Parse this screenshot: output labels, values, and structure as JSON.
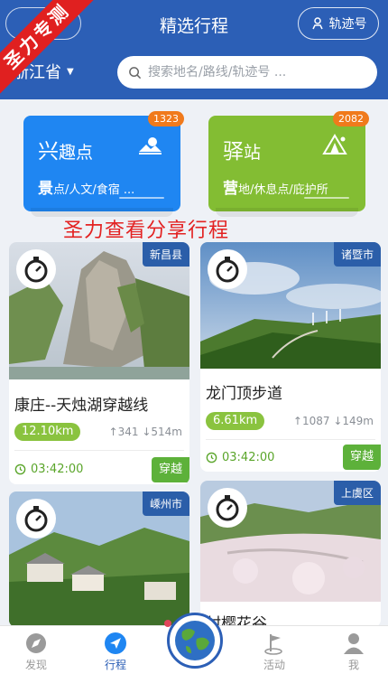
{
  "header": {
    "title": "精选行程",
    "track_button_label": "轨迹号",
    "region": "浙江省",
    "search_placeholder": "搜索地名/路线/轨迹号 ..."
  },
  "ribbon_text": "圣力专测",
  "categories": [
    {
      "title_lead": "兴",
      "title_rest": "趣点",
      "badge": "1323",
      "sub_lead": "景",
      "sub_rest": "点/人文/食宿 ...",
      "color": "#1f86f2"
    },
    {
      "title_lead": "驿",
      "title_rest": "站",
      "badge": "2082",
      "sub_lead": "营",
      "sub_rest": "地/休息点/庇护所",
      "color": "#83bd33"
    }
  ],
  "share_banner": "圣力查看分享行程",
  "trips": [
    {
      "county": "新昌县",
      "name": "康庄--天烛湖穿越线",
      "distance": "12.10km",
      "ascent": "341",
      "descent": "514m",
      "duration": "03:42:00",
      "action": "穿越"
    },
    {
      "county": "诸暨市",
      "name": "龙门顶步道",
      "distance": "6.61km",
      "ascent": "1087",
      "descent": "149m",
      "duration": "03:42:00",
      "action": "穿越"
    },
    {
      "county": "嵊州市"
    },
    {
      "county": "上虞区",
      "name_partial": "村樱花谷"
    }
  ],
  "nav": {
    "items": [
      {
        "label": "发现",
        "icon": "discover-icon"
      },
      {
        "label": "行程",
        "icon": "navigate-icon"
      },
      {
        "label": "活动",
        "icon": "flag-icon"
      },
      {
        "label": "我",
        "icon": "person-icon"
      }
    ],
    "center_icon": "globe-icon"
  },
  "colors": {
    "brand_blue": "#2c5fb6",
    "poi_blue": "#1f86f2",
    "station_green": "#83bd33",
    "badge_orange": "#f07a1c",
    "banner_red": "#e32222"
  }
}
